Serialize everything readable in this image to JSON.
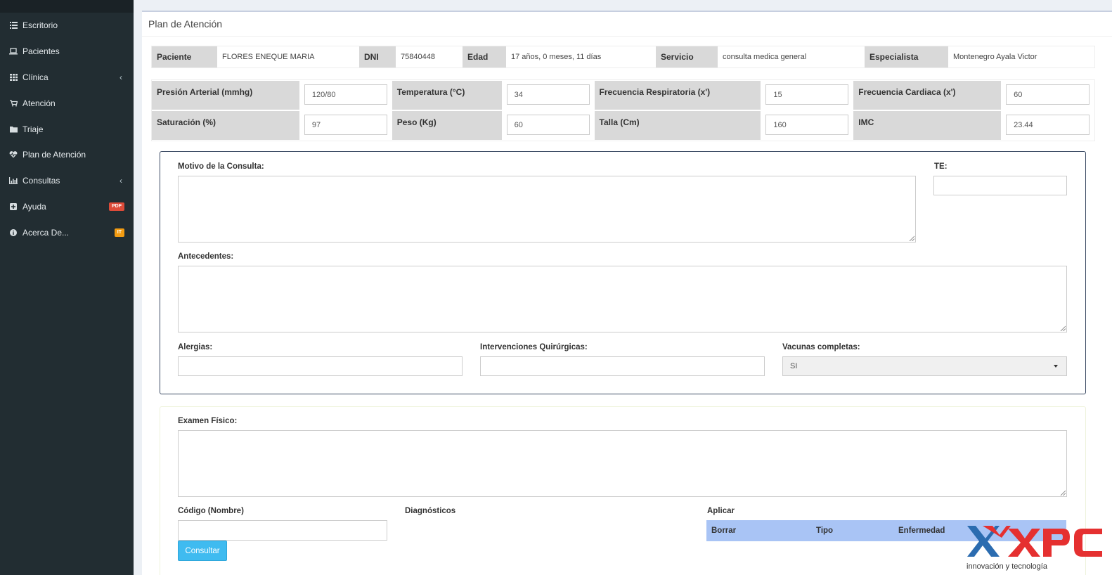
{
  "sidebar": {
    "items": [
      {
        "label": "Escritorio",
        "icon": "dashboard-icon"
      },
      {
        "label": "Pacientes",
        "icon": "laptop-icon"
      },
      {
        "label": "Clínica",
        "icon": "grid-icon"
      },
      {
        "label": "Atención",
        "icon": "cart-icon"
      },
      {
        "label": "Triaje",
        "icon": "folder-icon"
      },
      {
        "label": "Plan de Atención",
        "icon": "heartbeat-icon"
      },
      {
        "label": "Consultas",
        "icon": "bar-chart-icon"
      },
      {
        "label": "Ayuda",
        "icon": "plus-square-icon",
        "badge": "PDF",
        "badge_color": "#dd4b39"
      },
      {
        "label": "Acerca De...",
        "icon": "info-icon",
        "badge": "IT",
        "badge_color": "#f39c12"
      }
    ]
  },
  "page": {
    "title": "Plan de Atención"
  },
  "patient": {
    "paciente_label": "Paciente",
    "paciente": "FLORES ENEQUE MARIA",
    "dni_label": "DNI",
    "dni": "75840448",
    "edad_label": "Edad",
    "edad": "17 años, 0 meses, 11 días",
    "servicio_label": "Servicio",
    "servicio": "consulta medica general",
    "especialista_label": "Especialista",
    "especialista": "Montenegro Ayala Victor"
  },
  "vitals": {
    "presion_label": "Presión Arterial (mmhg)",
    "presion": "120/80",
    "temperatura_label": "Temperatura (°C)",
    "temperatura": "34",
    "frec_resp_label": "Frecuencia Respiratoria (x')",
    "frec_resp": "15",
    "frec_card_label": "Frecuencia Cardiaca (x')",
    "frec_card": "60",
    "saturacion_label": "Saturación (%)",
    "saturacion": "97",
    "peso_label": "Peso (Kg)",
    "peso": "60",
    "talla_label": "Talla (Cm)",
    "talla": "160",
    "imc_label": "IMC",
    "imc": "23.44"
  },
  "form": {
    "motivo_label": "Motivo de la Consulta:",
    "te_label": "TE:",
    "antecedentes_label": "Antecedentes:",
    "alergias_label": "Alergias:",
    "intervenciones_label": "Intervenciones Quirúrgicas:",
    "vacunas_label": "Vacunas completas:",
    "vacunas_value": "SI",
    "examen_label": "Examen Físico:",
    "codigo_label": "Código (Nombre)",
    "diagnosticos_label": "Diagnósticos",
    "aplicar_label": "Aplicar",
    "col_borrar": "Borrar",
    "col_tipo": "Tipo",
    "col_enfermedad": "Enfermedad",
    "consultar_button": "Consultar"
  },
  "watermark": {
    "brand": "XPC",
    "tagline": "innovación y tecnología"
  },
  "colors": {
    "sidebar": "#222d32",
    "button": "#3fbbf0",
    "table_header": "#a9c4f5"
  }
}
